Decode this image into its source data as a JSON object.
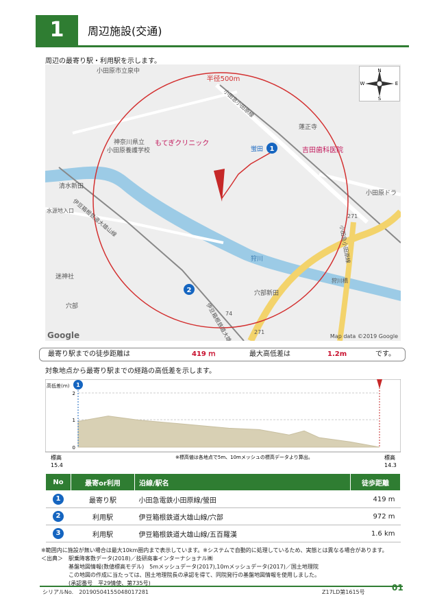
{
  "header": {
    "number": "1",
    "title": "周辺施設(交通)"
  },
  "map_caption": "周辺の最寄り駅・利用駅を示します。",
  "map": {
    "radius_label": "半径500m",
    "labels": [
      "小田原市立泉中",
      "神奈川県立",
      "小田原養護学校",
      "もてぎクリニック",
      "吉田歯科医院",
      "蛍田",
      "蓮正寺",
      "小田原ドラ",
      "狩川",
      "清水新田",
      "水源地入口",
      "伊豆箱根鉄道大雄山線",
      "小田急小田原線",
      "穴部",
      "穴部新田",
      "迷神社",
      "狩川橋",
      "小田急小田原線",
      "伊豆箱根鉄道大雄山線"
    ],
    "road_numbers": [
      "74",
      "271",
      "271"
    ],
    "google": "Google",
    "copyright": "Map data ©2019 Google",
    "compass": {
      "n": "N",
      "s": "S",
      "e": "E",
      "w": "W"
    },
    "markers": [
      {
        "id": "1",
        "name": "蛍田"
      },
      {
        "id": "2",
        "name": "穴部"
      }
    ]
  },
  "distance_bar": {
    "label1": "最寄り駅までの徒歩距離は",
    "value1": "419 ｍ",
    "label2": "最大高低差は",
    "value2": "1.2m",
    "suffix": "です。"
  },
  "profile_caption": "対象地点から最寄り駅までの経路の高低差を示します。",
  "profile": {
    "ylabel": "高低差(ｍ)",
    "yticks": [
      "2",
      "1",
      "0"
    ],
    "start_label": "標高",
    "start_value": "15.4",
    "end_label": "標高",
    "end_value": "14.3",
    "note": "※標高値は各地点で5m、10mメッシュの標高データより算出。",
    "marker": "1",
    "points": [
      [
        0,
        0.95
      ],
      [
        0.1,
        1.15
      ],
      [
        0.2,
        1.0
      ],
      [
        0.35,
        0.85
      ],
      [
        0.5,
        0.7
      ],
      [
        0.6,
        0.65
      ],
      [
        0.65,
        0.55
      ],
      [
        0.7,
        0.45
      ],
      [
        0.75,
        0.6
      ],
      [
        0.8,
        0.35
      ],
      [
        0.9,
        0.2
      ],
      [
        1.0,
        0.0
      ]
    ]
  },
  "table": {
    "headers": [
      "No",
      "最寄or利用",
      "沿線/駅名",
      "徒歩距離"
    ],
    "rows": [
      {
        "no": "1",
        "type": "最寄り駅",
        "station": "小田急電鉄小田原線/螢田",
        "dist": "419 m"
      },
      {
        "no": "2",
        "type": "利用駅",
        "station": "伊豆箱根鉄道大雄山線/穴部",
        "dist": "972 m"
      },
      {
        "no": "3",
        "type": "利用駅",
        "station": "伊豆箱根鉄道大雄山線/五百羅漢",
        "dist": "1.6 km"
      }
    ]
  },
  "notes": [
    "※範囲内に施設が無い場合は最大10km圏内まで表示しています。※システムで自動的に処理しているため、実態とは異なる場合があります。",
    "＜出典＞　駅乗降客数データ(2018)／技研商事インターナショナル㈱",
    "　　　　　基盤地図情報(数値標高モデル)　5mメッシュデータ(2017),10mメッシュデータ(2017)／国土地理院",
    "　　　　　この地図の作成に当たっては、国土地理院長の承認を得て、同院発行の基盤地図情報を使用しました。",
    "　　　　　(承認番号　平29情使、第735号)"
  ],
  "footer": {
    "serial": "シリアルNo.　20190504155048017281",
    "code": "Z17LD第1615号",
    "page": "01"
  }
}
